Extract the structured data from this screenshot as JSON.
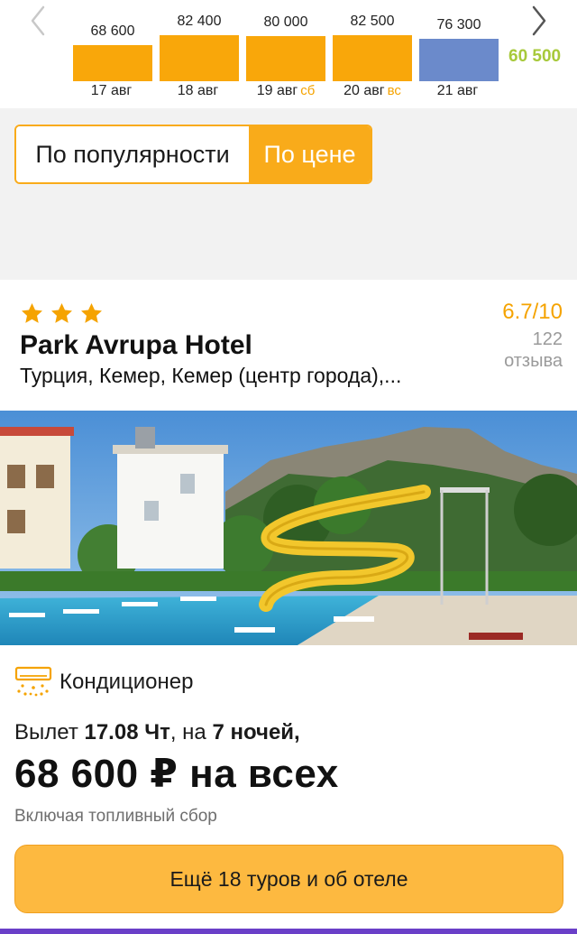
{
  "calendar": {
    "days": [
      {
        "price": "68 600",
        "date": "17 авг",
        "weekday": "",
        "color": "#f9a70a",
        "level": 0.55
      },
      {
        "price": "82 400",
        "date": "18 авг",
        "weekday": "",
        "color": "#f9a70a",
        "level": 0.7
      },
      {
        "price": "80 000",
        "date": "19 авг",
        "weekday": "сб",
        "color": "#f9a70a",
        "level": 0.68
      },
      {
        "price": "82 500",
        "date": "20 авг",
        "weekday": "вс",
        "color": "#f9a70a",
        "level": 0.7
      },
      {
        "price": "76 300",
        "date": "21 авг",
        "weekday": "",
        "color": "#6b8acb",
        "level": 0.64
      }
    ],
    "extra_price": "60 500",
    "prev_icon": "chevron-left-icon",
    "next_icon": "chevron-right-icon"
  },
  "sort": {
    "popular_label": "По популярности",
    "price_label": "По цене",
    "active": "price"
  },
  "hotel": {
    "stars": 3,
    "name": "Park Avrupa Hotel",
    "location": "Турция, Кемер, Кемер (центр города),...",
    "rating_score": "6.7/10",
    "rating_count": "122",
    "rating_count_label": "отзыва"
  },
  "amenity": {
    "icon": "air-conditioner-icon",
    "label": "Кондиционер"
  },
  "offer": {
    "departure_prefix": "Вылет ",
    "departure_date": "17.08 Чт",
    "departure_mid": ", на ",
    "nights": "7 ночей",
    "departure_suffix": ",",
    "price": "68 600 ₽ на всех",
    "note": "Включая топливный сбор",
    "more_button": "Ещё 18 туров и об отеле"
  },
  "colors": {
    "accent": "#f9ab1a",
    "rating": "#f5a300",
    "bar_orange": "#f9a70a",
    "bar_blue": "#6b8acb",
    "extra_price": "#a7c93a",
    "bottom_stripe": "#6a3fc8"
  }
}
